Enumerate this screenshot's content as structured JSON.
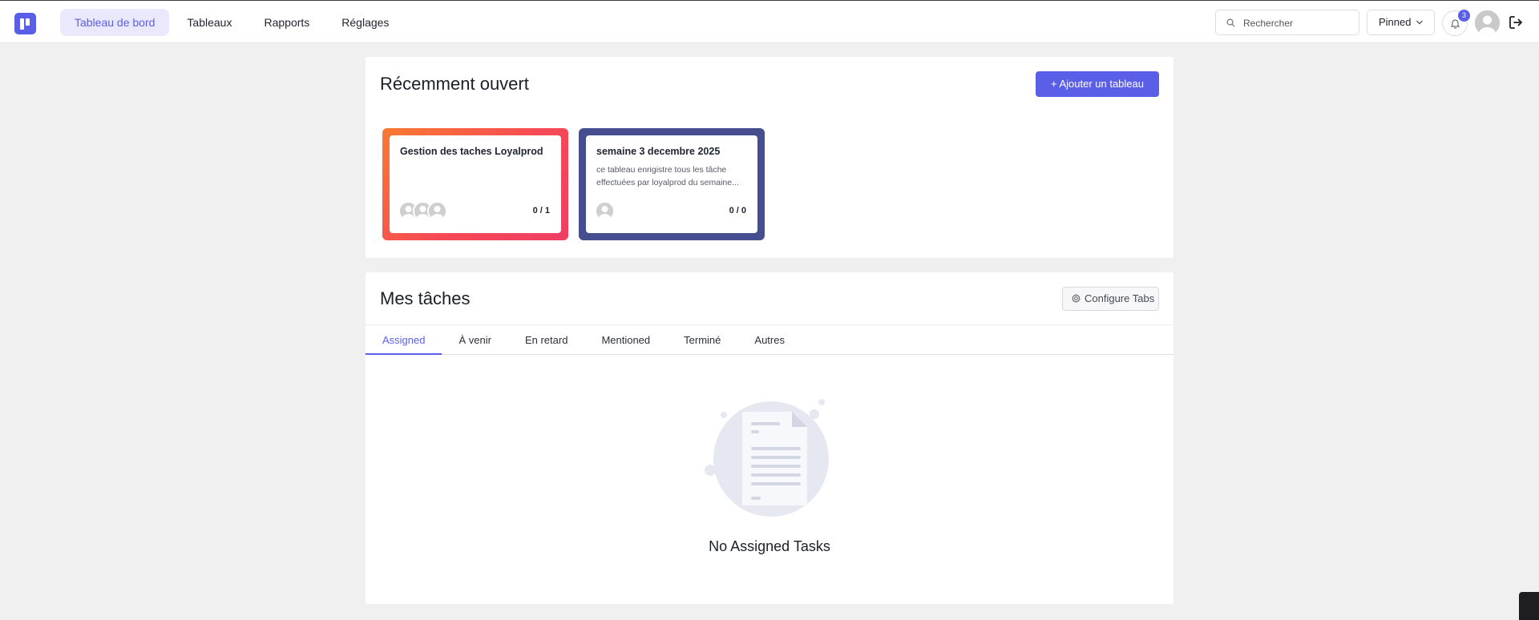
{
  "nav": {
    "items": [
      {
        "label": "Tableau de bord",
        "active": true
      },
      {
        "label": "Tableaux",
        "active": false
      },
      {
        "label": "Rapports",
        "active": false
      },
      {
        "label": "Réglages",
        "active": false
      }
    ]
  },
  "header": {
    "search_placeholder": "Rechercher",
    "pinned_label": "Pinned",
    "notification_count": "3"
  },
  "recent": {
    "title": "Récemment ouvert",
    "add_button": "+ Ajouter un tableau",
    "boards": [
      {
        "title": "Gestion des taches Loyalprod",
        "description_lines": [],
        "count": "0 / 1",
        "members": 3
      },
      {
        "title": "semaine 3 decembre 2025",
        "description_lines": [
          "ce tableau enrigistre tous les tâche",
          "effectuées par loyalprod du semaine..."
        ],
        "count": "0 / 0",
        "members": 1
      }
    ]
  },
  "tasks": {
    "title": "Mes tâches",
    "configure_button": "Configure Tabs",
    "tabs": [
      "Assigned",
      "À venir",
      "En retard",
      "Mentioned",
      "Terminé",
      "Autres"
    ],
    "active_tab": "Assigned",
    "empty_message": "No Assigned Tasks"
  },
  "colors": {
    "accent": "#5b5fe8",
    "board1_gradient_start": "#f97a32",
    "board1_gradient_end": "#f03e63",
    "board2": "#474e8f"
  },
  "icons": [
    "search-icon",
    "chevron-down-icon",
    "bell-icon",
    "user-avatar-icon",
    "logout-icon",
    "gear-icon",
    "document-icon"
  ]
}
